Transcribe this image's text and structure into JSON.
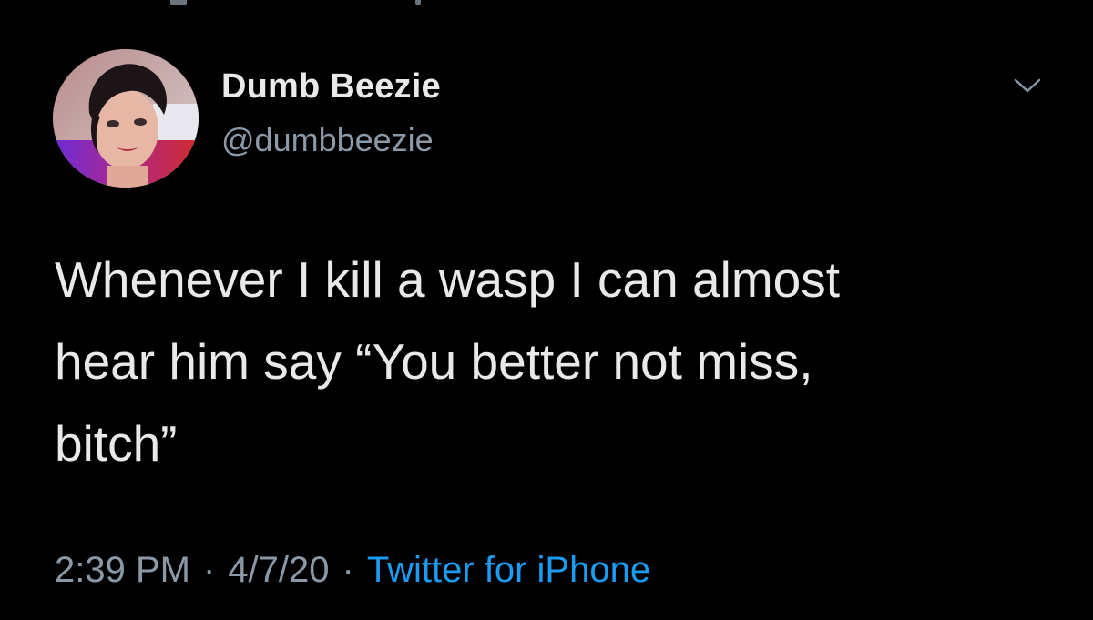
{
  "tweet": {
    "display_name": "Dumb Beezie",
    "handle": "@dumbbeezie",
    "text_lines": [
      "Whenever I kill a wasp I can almost",
      "hear him say “You better not miss,",
      "bitch”"
    ],
    "time": "2:39 PM",
    "date": "4/7/20",
    "separator": "·",
    "source": "Twitter for iPhone"
  },
  "icons": {
    "more_menu": "chevron-down-icon"
  },
  "colors": {
    "background": "#000000",
    "primary_text": "#e7e9ea",
    "secondary_text": "#8b98a5",
    "link": "#1d9bf0"
  }
}
